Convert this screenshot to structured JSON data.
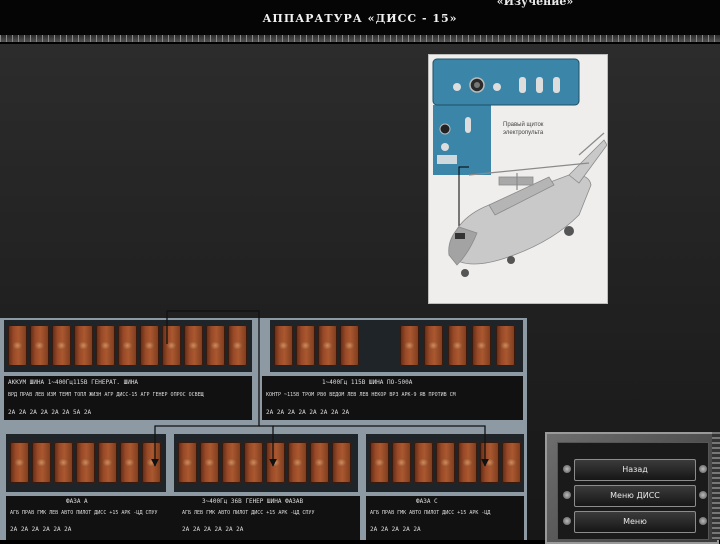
{
  "header": {
    "title": "АППАРАТУРА «ДИСС - 15»",
    "mode": "«Изучение»"
  },
  "picture": {
    "callout": "Правый щиток электропульта"
  },
  "panel": {
    "top_row": {
      "section_left": "АККУМ ШИНА 1~400Гц115В ГЕНЕРАТ. ШИНА",
      "left_labels": "ВРД ПРАВ  ЛЕВ  ИЗМ ТЕМП  ТОПЛ  ЖИЗН АГР  ДИСС-15  АГР  ГЕНЕР ОПРОС ОСВЕЩ",
      "left_amps": "2А  2А  2А  2А  2А  2А  5А  2А",
      "section_right": "1~400Гц 115В ШИНА ПО-500А",
      "right_labels": "КОНТР ~115В  ТРОМ РВ0  ВЕДОМ ЛЕВ  ЛЕВ НЕКОР  ВРЗ  АРК-9  ЯВ  ПРОТИВ СМ",
      "right_amps": "2А  2А  2А  2А  2А  2А  2А  2А"
    },
    "bottom_row": {
      "section_left": "ФАЗА А",
      "left_labels": "АГБ ПРАВ  ГМК ЛЕВ  АВТО ПИЛОТ  ДИСС +15  АРК -ЦД  СПУУ",
      "left_amps": "2А  2А  2А  2А  2А  2А",
      "section_mid": "3~400Гц 36В ГЕНЕР ШИНА ФАЗАВ",
      "mid_labels": "АГБ ЛЕВ  ГМК  АВТО ПИЛОТ  ДИСС +15  АРК -ЦД  СПУУ",
      "mid_amps": "2А  2А  2А  2А  2А  2А",
      "section_right": "ФАЗА С",
      "right_labels": "АГБ ПРАВ  ГМК  АВТО ПИЛОТ  ДИСС +15  АРК -ЦД",
      "right_amps": "2А  2А  2А  2А  2А"
    }
  },
  "menu": {
    "items": [
      {
        "label": "Назад"
      },
      {
        "label": "Меню ДИСС"
      },
      {
        "label": "Меню"
      }
    ]
  },
  "colors": {
    "fuse": "#9a4a28",
    "panel": "#8d9aa4",
    "background": "#1f1f1f"
  }
}
